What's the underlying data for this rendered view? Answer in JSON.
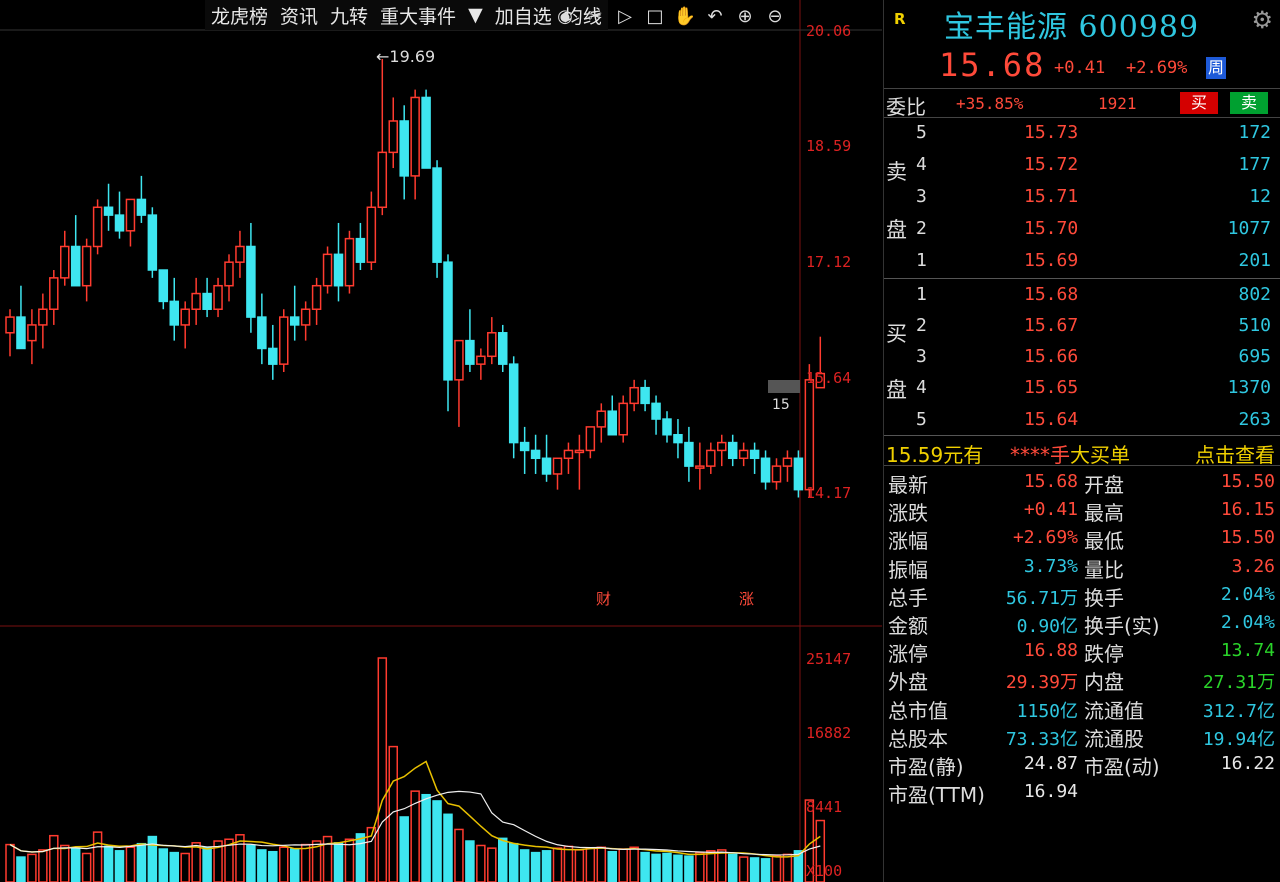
{
  "toolbar": {
    "items": [
      "龙虎榜",
      "资讯",
      "九转",
      "重大事件",
      "加自选",
      "均线"
    ],
    "dropdown": "▼",
    "icons": [
      "eye-icon",
      "scissors-icon",
      "play-icon",
      "lock-icon",
      "hand-icon",
      "undo-icon",
      "zoom-in-icon",
      "zoom-out-icon"
    ]
  },
  "chart": {
    "price_axis": [
      "20.06",
      "18.59",
      "17.12",
      "15.64",
      "14.17"
    ],
    "volume_axis": [
      "25147",
      "16882",
      "8441",
      "X100"
    ],
    "high_marker": "19.69",
    "current_marker": "15",
    "event_markers": [
      "财",
      "涨"
    ],
    "colors": {
      "up": "#ff3b2f",
      "down": "#3ee6f0",
      "ma1": "#e8c000",
      "ma2": "#f0f0f0",
      "grid": "#7a1010"
    }
  },
  "chart_data": {
    "type": "candlestick",
    "ohlc": [
      [
        16.2,
        16.5,
        15.9,
        16.4
      ],
      [
        16.4,
        16.8,
        16.1,
        16.0
      ],
      [
        16.1,
        16.5,
        15.8,
        16.3
      ],
      [
        16.3,
        16.7,
        16.0,
        16.5
      ],
      [
        16.5,
        17.0,
        16.3,
        16.9
      ],
      [
        16.9,
        17.5,
        16.8,
        17.3
      ],
      [
        17.3,
        17.7,
        17.0,
        16.8
      ],
      [
        16.8,
        17.4,
        16.6,
        17.3
      ],
      [
        17.3,
        17.9,
        17.2,
        17.8
      ],
      [
        17.8,
        18.1,
        17.5,
        17.7
      ],
      [
        17.7,
        18.0,
        17.4,
        17.5
      ],
      [
        17.5,
        17.9,
        17.3,
        17.9
      ],
      [
        17.9,
        18.2,
        17.6,
        17.7
      ],
      [
        17.7,
        17.8,
        16.9,
        17.0
      ],
      [
        17.0,
        17.0,
        16.5,
        16.6
      ],
      [
        16.6,
        16.9,
        16.1,
        16.3
      ],
      [
        16.3,
        16.6,
        16.0,
        16.5
      ],
      [
        16.5,
        16.9,
        16.3,
        16.7
      ],
      [
        16.7,
        16.9,
        16.4,
        16.5
      ],
      [
        16.5,
        16.9,
        16.4,
        16.8
      ],
      [
        16.8,
        17.2,
        16.6,
        17.1
      ],
      [
        17.1,
        17.5,
        16.9,
        17.3
      ],
      [
        17.3,
        17.6,
        16.2,
        16.4
      ],
      [
        16.4,
        16.7,
        15.8,
        16.0
      ],
      [
        16.0,
        16.3,
        15.6,
        15.8
      ],
      [
        15.8,
        16.5,
        15.7,
        16.4
      ],
      [
        16.4,
        16.8,
        16.1,
        16.3
      ],
      [
        16.3,
        16.6,
        16.1,
        16.5
      ],
      [
        16.5,
        16.9,
        16.3,
        16.8
      ],
      [
        16.8,
        17.3,
        16.7,
        17.2
      ],
      [
        17.2,
        17.6,
        16.6,
        16.8
      ],
      [
        16.8,
        17.5,
        16.7,
        17.4
      ],
      [
        17.4,
        17.6,
        17.0,
        17.1
      ],
      [
        17.1,
        18.0,
        17.0,
        17.8
      ],
      [
        17.8,
        19.69,
        17.7,
        18.5
      ],
      [
        18.5,
        19.2,
        18.3,
        18.9
      ],
      [
        18.9,
        19.1,
        17.9,
        18.2
      ],
      [
        18.2,
        19.3,
        17.9,
        19.2
      ],
      [
        19.2,
        19.3,
        18.3,
        18.3
      ],
      [
        18.3,
        18.4,
        16.9,
        17.1
      ],
      [
        17.1,
        17.2,
        15.2,
        15.6
      ],
      [
        15.6,
        16.0,
        15.0,
        16.1
      ],
      [
        16.1,
        16.5,
        15.7,
        15.8
      ],
      [
        15.8,
        16.0,
        15.6,
        15.9
      ],
      [
        15.9,
        16.4,
        15.8,
        16.2
      ],
      [
        16.2,
        16.3,
        15.7,
        15.8
      ],
      [
        15.8,
        15.9,
        14.6,
        14.8
      ],
      [
        14.8,
        15.0,
        14.4,
        14.7
      ],
      [
        14.7,
        14.9,
        14.4,
        14.6
      ],
      [
        14.6,
        14.9,
        14.3,
        14.4
      ],
      [
        14.4,
        14.6,
        14.2,
        14.6
      ],
      [
        14.6,
        14.8,
        14.4,
        14.7
      ],
      [
        14.7,
        14.9,
        14.2,
        14.7
      ],
      [
        14.7,
        15.0,
        14.6,
        15.0
      ],
      [
        15.0,
        15.3,
        14.8,
        15.2
      ],
      [
        15.2,
        15.4,
        14.9,
        14.9
      ],
      [
        14.9,
        15.4,
        14.8,
        15.3
      ],
      [
        15.3,
        15.6,
        15.2,
        15.5
      ],
      [
        15.5,
        15.6,
        15.2,
        15.3
      ],
      [
        15.3,
        15.4,
        14.9,
        15.1
      ],
      [
        15.1,
        15.2,
        14.8,
        14.9
      ],
      [
        14.9,
        15.1,
        14.6,
        14.8
      ],
      [
        14.8,
        15.0,
        14.3,
        14.5
      ],
      [
        14.5,
        14.8,
        14.2,
        14.5
      ],
      [
        14.5,
        14.8,
        14.4,
        14.7
      ],
      [
        14.7,
        14.9,
        14.5,
        14.8
      ],
      [
        14.8,
        14.9,
        14.5,
        14.6
      ],
      [
        14.6,
        14.8,
        14.5,
        14.7
      ],
      [
        14.7,
        14.8,
        14.4,
        14.6
      ],
      [
        14.6,
        14.7,
        14.2,
        14.3
      ],
      [
        14.3,
        14.6,
        14.2,
        14.5
      ],
      [
        14.5,
        14.7,
        14.3,
        14.6
      ],
      [
        14.6,
        14.7,
        14.1,
        14.2
      ],
      [
        14.2,
        15.8,
        14.1,
        15.6
      ],
      [
        15.5,
        16.15,
        15.5,
        15.68
      ]
    ],
    "volumes": [
      4200,
      2800,
      3100,
      3600,
      5200,
      4100,
      3800,
      3200,
      5600,
      4000,
      3500,
      3900,
      4300,
      5100,
      3700,
      3300,
      3200,
      4400,
      3900,
      4600,
      4800,
      5300,
      4100,
      3600,
      3400,
      3900,
      3700,
      4200,
      4600,
      5100,
      4400,
      4800,
      5400,
      6100,
      25147,
      15200,
      7300,
      10200,
      9800,
      9100,
      7600,
      5900,
      4600,
      4100,
      3800,
      4900,
      4300,
      3600,
      3300,
      3500,
      3800,
      4000,
      3600,
      3800,
      3900,
      3400,
      3700,
      3900,
      3300,
      3100,
      3200,
      3000,
      2900,
      3300,
      3500,
      3600,
      3100,
      2800,
      2700,
      2600,
      2900,
      3100,
      3500,
      9200,
      6900
    ],
    "ylim": [
      13.5,
      20.3
    ]
  },
  "header": {
    "market_badge": "R",
    "name": "宝丰能源",
    "code": "600989",
    "price": "15.68",
    "change": "+0.41",
    "change_pct": "+2.69%",
    "period_badge": "周"
  },
  "wb": {
    "label": "委比",
    "ratio": "+35.85%",
    "diff": "1921",
    "buy": "买",
    "sell": "卖"
  },
  "asks": [
    {
      "lvl": "5",
      "price": "15.73",
      "qty": "172"
    },
    {
      "lvl": "4",
      "price": "15.72",
      "qty": "177"
    },
    {
      "lvl": "3",
      "price": "15.71",
      "qty": "12"
    },
    {
      "lvl": "2",
      "price": "15.70",
      "qty": "1077"
    },
    {
      "lvl": "1",
      "price": "15.69",
      "qty": "201"
    }
  ],
  "bids": [
    {
      "lvl": "1",
      "price": "15.68",
      "qty": "802"
    },
    {
      "lvl": "2",
      "price": "15.67",
      "qty": "510"
    },
    {
      "lvl": "3",
      "price": "15.66",
      "qty": "695"
    },
    {
      "lvl": "4",
      "price": "15.65",
      "qty": "1370"
    },
    {
      "lvl": "5",
      "price": "15.64",
      "qty": "263"
    }
  ],
  "ask_label": [
    "卖",
    "盘"
  ],
  "bid_label": [
    "买",
    "盘"
  ],
  "big_order": {
    "price": "15.59元有",
    "hand": "****手",
    "title": "大买单",
    "link": "点击查看"
  },
  "stats": [
    {
      "l1": "最新",
      "v1": "15.68",
      "c1": "red",
      "l2": "开盘",
      "v2": "15.50",
      "c2": "red"
    },
    {
      "l1": "涨跌",
      "v1": "+0.41",
      "c1": "red",
      "l2": "最高",
      "v2": "16.15",
      "c2": "red"
    },
    {
      "l1": "涨幅",
      "v1": "+2.69%",
      "c1": "red",
      "l2": "最低",
      "v2": "15.50",
      "c2": "red"
    },
    {
      "l1": "振幅",
      "v1": "3.73%",
      "c1": "cyan",
      "l2": "量比",
      "v2": "3.26",
      "c2": "red"
    },
    {
      "l1": "总手",
      "v1": "56.71万",
      "c1": "cyan",
      "l2": "换手",
      "v2": "2.04%",
      "c2": "cyan"
    },
    {
      "l1": "金额",
      "v1": "0.90亿",
      "c1": "cyan",
      "l2": "换手(实)",
      "v2": "2.04%",
      "c2": "cyan"
    },
    {
      "l1": "涨停",
      "v1": "16.88",
      "c1": "red",
      "l2": "跌停",
      "v2": "13.74",
      "c2": "green"
    },
    {
      "l1": "外盘",
      "v1": "29.39万",
      "c1": "red",
      "l2": "内盘",
      "v2": "27.31万",
      "c2": "green"
    },
    {
      "l1": "总市值",
      "v1": "1150亿",
      "c1": "cyan",
      "l2": "流通值",
      "v2": "312.7亿",
      "c2": "cyan"
    },
    {
      "l1": "总股本",
      "v1": "73.33亿",
      "c1": "cyan",
      "l2": "流通股",
      "v2": "19.94亿",
      "c2": "cyan"
    },
    {
      "l1": "市盈(静)",
      "v1": "24.87",
      "c1": "white",
      "l2": "市盈(动)",
      "v2": "16.22",
      "c2": "white"
    },
    {
      "l1": "市盈(TTM)",
      "v1": "16.94",
      "c1": "white",
      "l2": "",
      "v2": "",
      "c2": "white"
    }
  ]
}
